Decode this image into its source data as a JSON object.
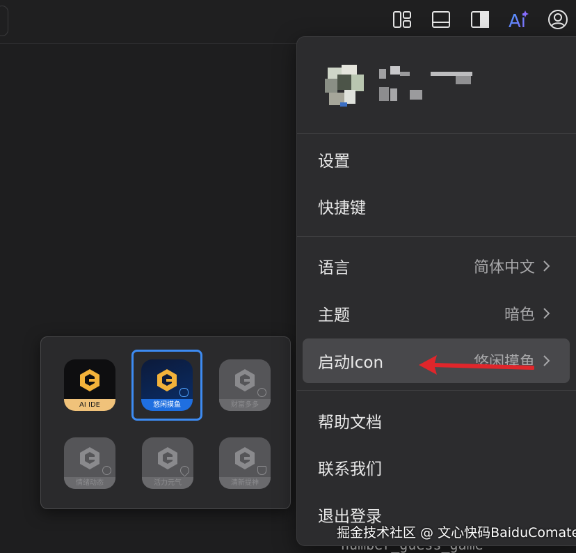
{
  "toolbar": {
    "icons": [
      "layout-icon",
      "panel-bottom-icon",
      "panel-right-icon",
      "ai-assistant-icon",
      "user-account-icon"
    ],
    "ai_label": "Ai"
  },
  "menu": {
    "items": [
      {
        "label": "设置"
      },
      {
        "label": "快捷键"
      },
      {
        "label": "语言",
        "value": "简体中文"
      },
      {
        "label": "主题",
        "value": "暗色"
      },
      {
        "label": "启动Icon",
        "value": "悠闲摸鱼"
      },
      {
        "label": "帮助文档"
      },
      {
        "label": "联系我们"
      },
      {
        "label": "退出登录"
      }
    ]
  },
  "icon_panel": {
    "options": [
      {
        "caption": "AI IDE",
        "selected": false,
        "style": "gold"
      },
      {
        "caption": "悠闲摸鱼",
        "selected": true,
        "style": "blue"
      },
      {
        "caption": "财富多多",
        "selected": false,
        "style": "gray"
      },
      {
        "caption": "情绪动态",
        "selected": false,
        "style": "gray"
      },
      {
        "caption": "活力元气",
        "selected": false,
        "style": "gray"
      },
      {
        "caption": "清新提神",
        "selected": false,
        "style": "gray"
      }
    ]
  },
  "background_code": "number_guess_game",
  "watermark": "掘金技术社区 @ 文心快码BaiduComate",
  "colors": {
    "accent_blue": "#3d8bf2",
    "annotation_red": "#e0262b",
    "menu_bg": "#2c2c2e"
  }
}
